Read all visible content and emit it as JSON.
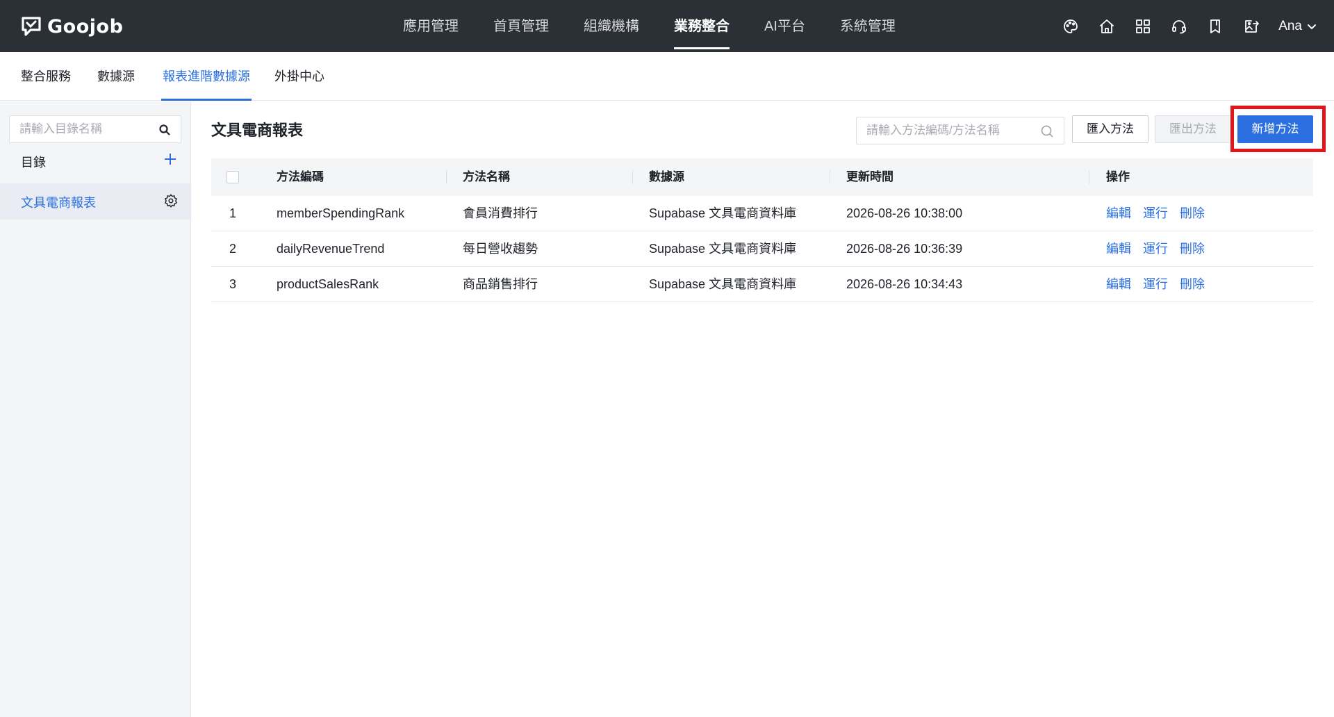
{
  "brand": {
    "name": "Goojob"
  },
  "mainnav": {
    "items": [
      {
        "label": "應用管理",
        "active": false
      },
      {
        "label": "首頁管理",
        "active": false
      },
      {
        "label": "組織機構",
        "active": false
      },
      {
        "label": "業務整合",
        "active": true
      },
      {
        "label": "AI平台",
        "active": false
      },
      {
        "label": "系統管理",
        "active": false
      }
    ]
  },
  "topbar": {
    "icons": [
      "palette-icon",
      "home-icon",
      "apps-grid-icon",
      "support-headset-icon",
      "bookmark-icon",
      "export-image-icon"
    ],
    "user_name": "Ana"
  },
  "subtabs": {
    "items": [
      {
        "label": "整合服務",
        "active": false
      },
      {
        "label": "數據源",
        "active": false
      },
      {
        "label": "報表進階數據源",
        "active": true
      },
      {
        "label": "外掛中心",
        "active": false
      }
    ]
  },
  "sidebar": {
    "search_placeholder": "請輸入目錄名稱",
    "directory_label": "目錄",
    "items": [
      {
        "label": "文具電商報表",
        "selected": true
      }
    ]
  },
  "main": {
    "title": "文具電商報表",
    "search_placeholder": "請輸入方法編碼/方法名稱",
    "import_label": "匯入方法",
    "export_label": "匯出方法",
    "add_label": "新增方法",
    "highlight_color": "#e0161d",
    "accent_color": "#2b6fe0"
  },
  "table": {
    "headers": {
      "code": "方法編碼",
      "name": "方法名稱",
      "source": "數據源",
      "updated": "更新時間",
      "ops": "操作"
    },
    "rows": [
      {
        "index": "1",
        "code": "memberSpendingRank",
        "name": "會員消費排行",
        "source": "Supabase 文具電商資料庫",
        "updated": "2026-08-26 10:38:00"
      },
      {
        "index": "2",
        "code": "dailyRevenueTrend",
        "name": "每日營收趨勢",
        "source": "Supabase 文具電商資料庫",
        "updated": "2026-08-26 10:36:39"
      },
      {
        "index": "3",
        "code": "productSalesRank",
        "name": "商品銷售排行",
        "source": "Supabase 文具電商資料庫",
        "updated": "2026-08-26 10:34:43"
      }
    ],
    "actions": {
      "edit": "編輯",
      "run": "運行",
      "delete": "刪除"
    }
  }
}
